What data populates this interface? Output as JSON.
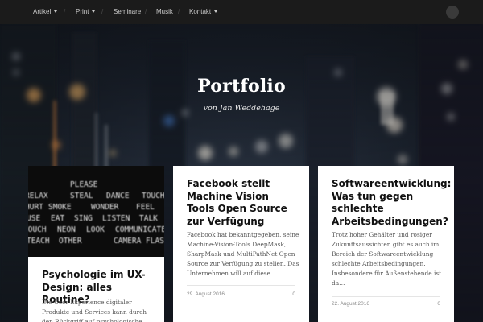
{
  "nav": {
    "items": [
      {
        "label": "Artikel",
        "dropdown": true
      },
      {
        "label": "Print",
        "dropdown": true
      },
      {
        "label": "Seminare",
        "dropdown": false
      },
      {
        "label": "Musik",
        "dropdown": false
      },
      {
        "label": "Kontakt",
        "dropdown": true
      }
    ],
    "separator": "/"
  },
  "hero": {
    "title": "Portfolio",
    "subtitle": "von Jan Weddehage"
  },
  "cards": [
    {
      "image_words": [
        "PLEASE",
        "RELAX",
        "STEAL",
        "DANCE",
        "TOUCH",
        "HURT",
        "SMOKE",
        "WONDER",
        "FEEL",
        "USE",
        "EAT",
        "SING",
        "LISTEN",
        "TALK",
        "TOUCH",
        "NEON",
        "LOOK",
        "COMMUNICATE",
        "TEACH",
        "OTHER",
        "CAMERA",
        "FLASH"
      ],
      "title": "Psychologie im UX-Design: alles Routine?",
      "excerpt": "Die User Experience digitaler Produkte und Services kann durch den Rückgriff auf psychologische"
    },
    {
      "title": "Facebook stellt Machine Vision Tools Open Source zur Verfügung",
      "excerpt": "Facebook hat bekanntgegeben, seine Machine-Vision-Tools DeepMask, SharpMask und MultiPathNet Open Source zur Verfügung zu stellen. Das Unternehmen will auf diese…",
      "date": "29. August 2016",
      "comments": "0"
    },
    {
      "title": "Softwareentwicklung: Was tun gegen schlechte Arbeitsbedingungen?",
      "excerpt": "Trotz hoher Gehälter und rosiger Zukunftsaussichten gibt es auch im Bereich der Softwareentwicklung schlechte Arbeitsbedingungen. Insbesondere für Außenstehende ist da…",
      "date": "22. August 2016",
      "comments": "0"
    }
  ]
}
